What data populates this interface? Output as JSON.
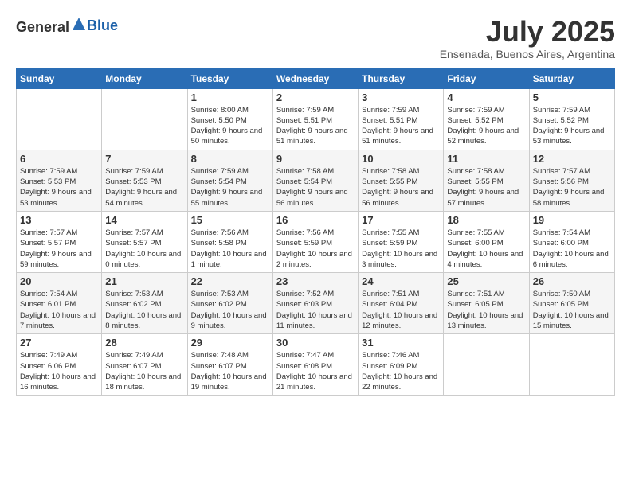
{
  "header": {
    "logo_general": "General",
    "logo_blue": "Blue",
    "month_year": "July 2025",
    "location": "Ensenada, Buenos Aires, Argentina"
  },
  "days_of_week": [
    "Sunday",
    "Monday",
    "Tuesday",
    "Wednesday",
    "Thursday",
    "Friday",
    "Saturday"
  ],
  "weeks": [
    [
      {
        "date": "",
        "sunrise": "",
        "sunset": "",
        "daylight": ""
      },
      {
        "date": "",
        "sunrise": "",
        "sunset": "",
        "daylight": ""
      },
      {
        "date": "1",
        "sunrise": "Sunrise: 8:00 AM",
        "sunset": "Sunset: 5:50 PM",
        "daylight": "Daylight: 9 hours and 50 minutes."
      },
      {
        "date": "2",
        "sunrise": "Sunrise: 7:59 AM",
        "sunset": "Sunset: 5:51 PM",
        "daylight": "Daylight: 9 hours and 51 minutes."
      },
      {
        "date": "3",
        "sunrise": "Sunrise: 7:59 AM",
        "sunset": "Sunset: 5:51 PM",
        "daylight": "Daylight: 9 hours and 51 minutes."
      },
      {
        "date": "4",
        "sunrise": "Sunrise: 7:59 AM",
        "sunset": "Sunset: 5:52 PM",
        "daylight": "Daylight: 9 hours and 52 minutes."
      },
      {
        "date": "5",
        "sunrise": "Sunrise: 7:59 AM",
        "sunset": "Sunset: 5:52 PM",
        "daylight": "Daylight: 9 hours and 53 minutes."
      }
    ],
    [
      {
        "date": "6",
        "sunrise": "Sunrise: 7:59 AM",
        "sunset": "Sunset: 5:53 PM",
        "daylight": "Daylight: 9 hours and 53 minutes."
      },
      {
        "date": "7",
        "sunrise": "Sunrise: 7:59 AM",
        "sunset": "Sunset: 5:53 PM",
        "daylight": "Daylight: 9 hours and 54 minutes."
      },
      {
        "date": "8",
        "sunrise": "Sunrise: 7:59 AM",
        "sunset": "Sunset: 5:54 PM",
        "daylight": "Daylight: 9 hours and 55 minutes."
      },
      {
        "date": "9",
        "sunrise": "Sunrise: 7:58 AM",
        "sunset": "Sunset: 5:54 PM",
        "daylight": "Daylight: 9 hours and 56 minutes."
      },
      {
        "date": "10",
        "sunrise": "Sunrise: 7:58 AM",
        "sunset": "Sunset: 5:55 PM",
        "daylight": "Daylight: 9 hours and 56 minutes."
      },
      {
        "date": "11",
        "sunrise": "Sunrise: 7:58 AM",
        "sunset": "Sunset: 5:55 PM",
        "daylight": "Daylight: 9 hours and 57 minutes."
      },
      {
        "date": "12",
        "sunrise": "Sunrise: 7:57 AM",
        "sunset": "Sunset: 5:56 PM",
        "daylight": "Daylight: 9 hours and 58 minutes."
      }
    ],
    [
      {
        "date": "13",
        "sunrise": "Sunrise: 7:57 AM",
        "sunset": "Sunset: 5:57 PM",
        "daylight": "Daylight: 9 hours and 59 minutes."
      },
      {
        "date": "14",
        "sunrise": "Sunrise: 7:57 AM",
        "sunset": "Sunset: 5:57 PM",
        "daylight": "Daylight: 10 hours and 0 minutes."
      },
      {
        "date": "15",
        "sunrise": "Sunrise: 7:56 AM",
        "sunset": "Sunset: 5:58 PM",
        "daylight": "Daylight: 10 hours and 1 minute."
      },
      {
        "date": "16",
        "sunrise": "Sunrise: 7:56 AM",
        "sunset": "Sunset: 5:59 PM",
        "daylight": "Daylight: 10 hours and 2 minutes."
      },
      {
        "date": "17",
        "sunrise": "Sunrise: 7:55 AM",
        "sunset": "Sunset: 5:59 PM",
        "daylight": "Daylight: 10 hours and 3 minutes."
      },
      {
        "date": "18",
        "sunrise": "Sunrise: 7:55 AM",
        "sunset": "Sunset: 6:00 PM",
        "daylight": "Daylight: 10 hours and 4 minutes."
      },
      {
        "date": "19",
        "sunrise": "Sunrise: 7:54 AM",
        "sunset": "Sunset: 6:00 PM",
        "daylight": "Daylight: 10 hours and 6 minutes."
      }
    ],
    [
      {
        "date": "20",
        "sunrise": "Sunrise: 7:54 AM",
        "sunset": "Sunset: 6:01 PM",
        "daylight": "Daylight: 10 hours and 7 minutes."
      },
      {
        "date": "21",
        "sunrise": "Sunrise: 7:53 AM",
        "sunset": "Sunset: 6:02 PM",
        "daylight": "Daylight: 10 hours and 8 minutes."
      },
      {
        "date": "22",
        "sunrise": "Sunrise: 7:53 AM",
        "sunset": "Sunset: 6:02 PM",
        "daylight": "Daylight: 10 hours and 9 minutes."
      },
      {
        "date": "23",
        "sunrise": "Sunrise: 7:52 AM",
        "sunset": "Sunset: 6:03 PM",
        "daylight": "Daylight: 10 hours and 11 minutes."
      },
      {
        "date": "24",
        "sunrise": "Sunrise: 7:51 AM",
        "sunset": "Sunset: 6:04 PM",
        "daylight": "Daylight: 10 hours and 12 minutes."
      },
      {
        "date": "25",
        "sunrise": "Sunrise: 7:51 AM",
        "sunset": "Sunset: 6:05 PM",
        "daylight": "Daylight: 10 hours and 13 minutes."
      },
      {
        "date": "26",
        "sunrise": "Sunrise: 7:50 AM",
        "sunset": "Sunset: 6:05 PM",
        "daylight": "Daylight: 10 hours and 15 minutes."
      }
    ],
    [
      {
        "date": "27",
        "sunrise": "Sunrise: 7:49 AM",
        "sunset": "Sunset: 6:06 PM",
        "daylight": "Daylight: 10 hours and 16 minutes."
      },
      {
        "date": "28",
        "sunrise": "Sunrise: 7:49 AM",
        "sunset": "Sunset: 6:07 PM",
        "daylight": "Daylight: 10 hours and 18 minutes."
      },
      {
        "date": "29",
        "sunrise": "Sunrise: 7:48 AM",
        "sunset": "Sunset: 6:07 PM",
        "daylight": "Daylight: 10 hours and 19 minutes."
      },
      {
        "date": "30",
        "sunrise": "Sunrise: 7:47 AM",
        "sunset": "Sunset: 6:08 PM",
        "daylight": "Daylight: 10 hours and 21 minutes."
      },
      {
        "date": "31",
        "sunrise": "Sunrise: 7:46 AM",
        "sunset": "Sunset: 6:09 PM",
        "daylight": "Daylight: 10 hours and 22 minutes."
      },
      {
        "date": "",
        "sunrise": "",
        "sunset": "",
        "daylight": ""
      },
      {
        "date": "",
        "sunrise": "",
        "sunset": "",
        "daylight": ""
      }
    ]
  ]
}
